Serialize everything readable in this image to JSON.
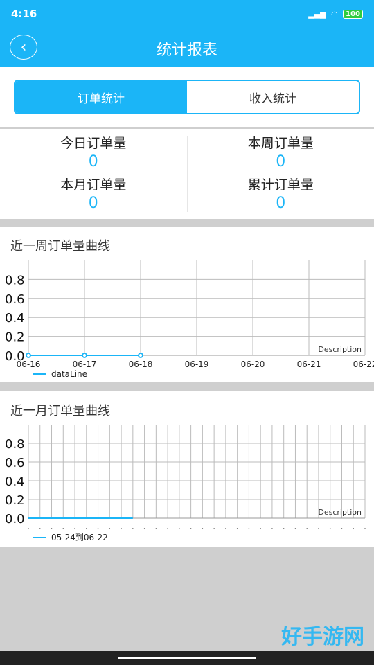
{
  "status": {
    "time": "4:16",
    "battery": "100"
  },
  "header": {
    "title": "统计报表"
  },
  "tabs": [
    {
      "label": "订单统计",
      "active": true
    },
    {
      "label": "收入统计",
      "active": false
    }
  ],
  "stats": [
    {
      "label": "今日订单量",
      "value": "0"
    },
    {
      "label": "本周订单量",
      "value": "0"
    },
    {
      "label": "本月订单量",
      "value": "0"
    },
    {
      "label": "累计订单量",
      "value": "0"
    }
  ],
  "colors": {
    "accent": "#1bb5f7"
  },
  "watermark": "好手游网",
  "chart_data": [
    {
      "type": "line",
      "title": "近一周订单量曲线",
      "description": "Description",
      "categories": [
        "06-16",
        "06-17",
        "06-18",
        "06-19",
        "06-20",
        "06-21",
        "06-22"
      ],
      "series": [
        {
          "name": "dataLine",
          "values": [
            0,
            0,
            0
          ]
        }
      ],
      "yticks": [
        "0.0",
        "0.2",
        "0.4",
        "0.6",
        "0.8"
      ],
      "ylim": [
        0,
        1
      ],
      "grid": true,
      "legend": "bottom-left",
      "markers": true
    },
    {
      "type": "line",
      "title": "近一月订单量曲线",
      "description": "Description",
      "num_categories": 30,
      "series": [
        {
          "name": "05-24到06-22",
          "values": [
            0,
            0,
            0,
            0,
            0,
            0,
            0,
            0,
            0,
            0
          ]
        }
      ],
      "yticks": [
        "0.0",
        "0.2",
        "0.4",
        "0.6",
        "0.8"
      ],
      "ylim": [
        0,
        1
      ],
      "grid": true,
      "legend": "bottom-left",
      "markers": false
    }
  ]
}
